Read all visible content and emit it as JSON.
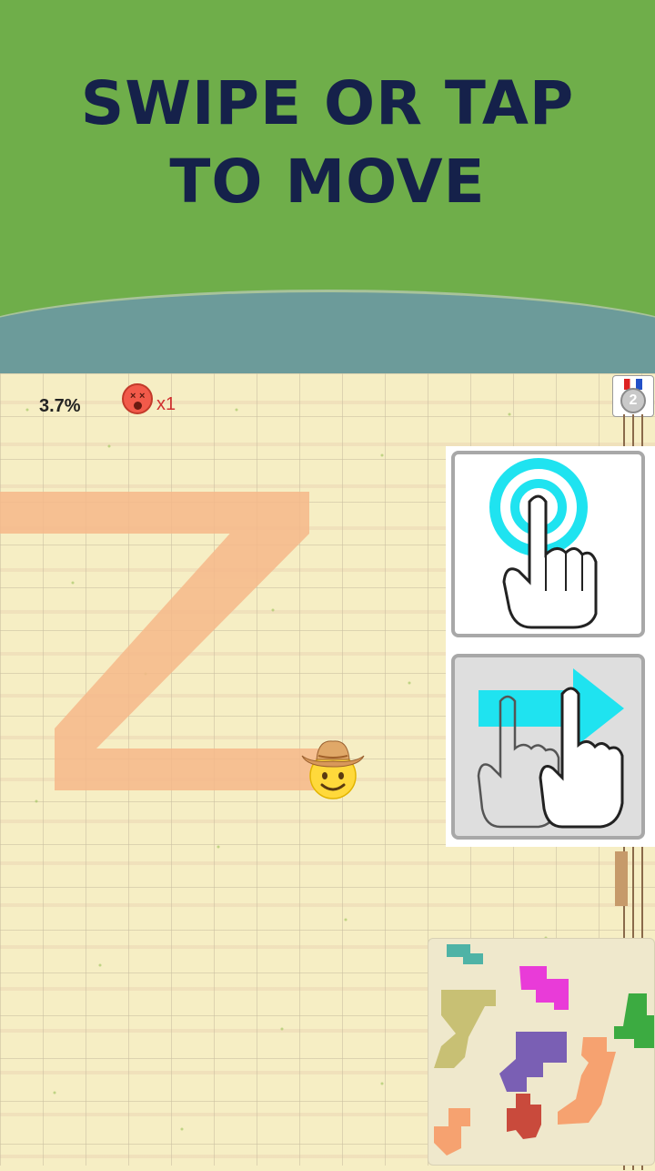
{
  "banner": {
    "line1": "SWIPE OR TAP",
    "line2": "TO MOVE",
    "bg_color": "#6fae4a",
    "text_color": "#15214a",
    "water_color": "#6c9b9a"
  },
  "hud": {
    "progress_text": "3.7%",
    "deaths_icon": "dizzy-face-icon",
    "deaths_text": "x1",
    "rank_icon": "second-place-medal-icon",
    "rank_number": "2"
  },
  "tutorial": {
    "tap_icon": "tap-gesture-icon",
    "swipe_icon": "swipe-right-gesture-icon",
    "accent_color": "#1fe3f0"
  },
  "player": {
    "icon": "cowboy-hat-face-icon"
  },
  "trail_color": "#f6b98a",
  "minimap": {
    "icon": "territory-minimap"
  }
}
